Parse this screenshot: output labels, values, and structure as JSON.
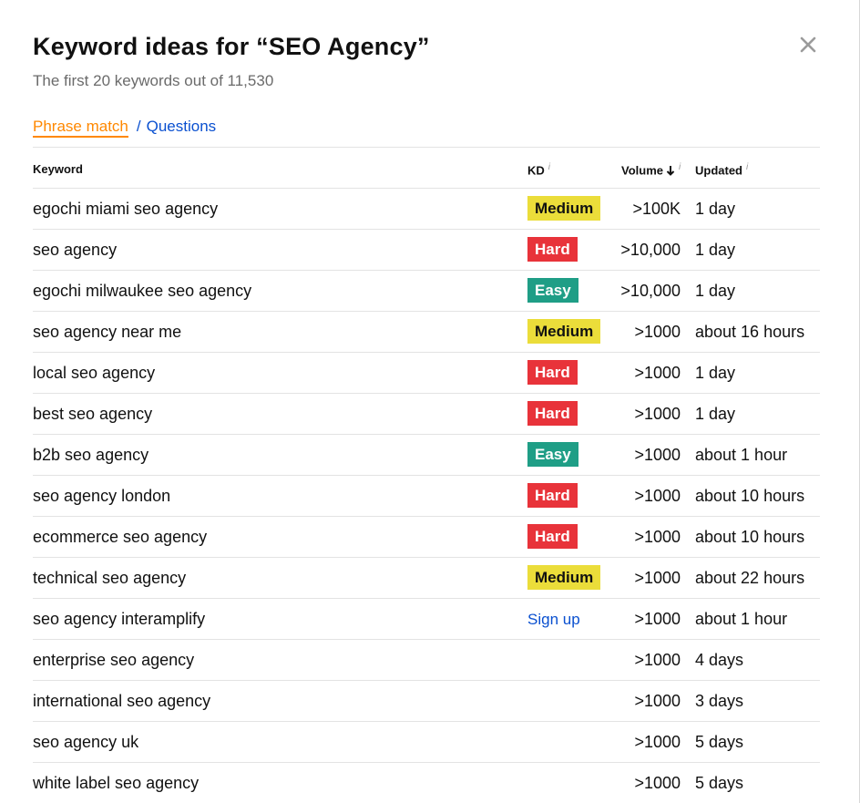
{
  "dialog": {
    "title": "Keyword ideas for “SEO Agency”",
    "subtitle": "The first 20 keywords out of 11,530",
    "close_icon": "close-icon"
  },
  "tabs": {
    "phrase_match": "Phrase match",
    "separator": "/",
    "questions": "Questions"
  },
  "colors": {
    "accent_orange": "#ff8800",
    "link_blue": "#0a50d0",
    "kd_medium": "#ebdd3a",
    "kd_hard": "#e8333a",
    "kd_easy": "#1f9e86"
  },
  "table": {
    "headers": {
      "keyword": "Keyword",
      "kd": "KD",
      "volume": "Volume",
      "updated": "Updated",
      "info_icon": "i"
    },
    "rows": [
      {
        "keyword": "egochi miami seo agency",
        "kd": "Medium",
        "volume": ">100K",
        "updated": "1 day"
      },
      {
        "keyword": "seo agency",
        "kd": "Hard",
        "volume": ">10,000",
        "updated": "1 day"
      },
      {
        "keyword": "egochi milwaukee seo agency",
        "kd": "Easy",
        "volume": ">10,000",
        "updated": "1 day"
      },
      {
        "keyword": "seo agency near me",
        "kd": "Medium",
        "volume": ">1000",
        "updated": "about 16 hours"
      },
      {
        "keyword": "local seo agency",
        "kd": "Hard",
        "volume": ">1000",
        "updated": "1 day"
      },
      {
        "keyword": "best seo agency",
        "kd": "Hard",
        "volume": ">1000",
        "updated": "1 day"
      },
      {
        "keyword": "b2b seo agency",
        "kd": "Easy",
        "volume": ">1000",
        "updated": "about 1 hour"
      },
      {
        "keyword": "seo agency london",
        "kd": "Hard",
        "volume": ">1000",
        "updated": "about 10 hours"
      },
      {
        "keyword": "ecommerce seo agency",
        "kd": "Hard",
        "volume": ">1000",
        "updated": "about 10 hours"
      },
      {
        "keyword": "technical seo agency",
        "kd": "Medium",
        "volume": ">1000",
        "updated": "about 22 hours"
      },
      {
        "keyword": "seo agency interamplify",
        "kd_link": "Sign up",
        "volume": ">1000",
        "updated": "about 1 hour"
      },
      {
        "keyword": "enterprise seo agency",
        "volume": ">1000",
        "updated": "4 days"
      },
      {
        "keyword": "international seo agency",
        "volume": ">1000",
        "updated": "3 days"
      },
      {
        "keyword": "seo agency uk",
        "volume": ">1000",
        "updated": "5 days"
      },
      {
        "keyword": "white label seo agency",
        "volume": ">1000",
        "updated": "5 days"
      }
    ]
  }
}
